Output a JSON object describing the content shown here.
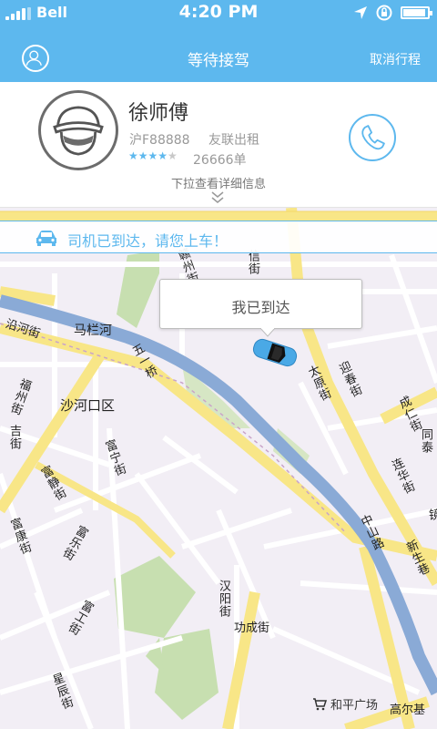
{
  "status_bar": {
    "carrier": "Bell",
    "time": "4:20 PM"
  },
  "nav": {
    "title": "等待接驾",
    "cancel_label": "取消行程",
    "profile_icon": "user-icon"
  },
  "driver": {
    "name": "徐师傅",
    "plate": "沪F88888",
    "company": "友联出租",
    "rating": {
      "value": 4,
      "max": 5,
      "stars_on": "★★★★",
      "stars_off": "★"
    },
    "orders": "26666单",
    "call_icon": "phone-icon",
    "pull_hint": "下拉查看详细信息"
  },
  "notice": {
    "icon": "car-icon",
    "text": "司机已到达，请您上车！"
  },
  "map": {
    "arrive_button": "我已到达",
    "labels": {
      "yanhe": "沿河街",
      "malan": "马栏河",
      "shahekou": "沙河口区",
      "wuyiqiao": "五一桥",
      "fuzhou": "福州街",
      "jixiang": "吉街",
      "fuquan": "富宁街",
      "fujing": "富静街",
      "fukang": "富康街",
      "fule": "富乐街",
      "fugong": "富工街",
      "xingchen": "星辰街",
      "hanyang": "汉阳街",
      "gongcheng": "功成街",
      "taiyuan": "太原街",
      "yingchun": "迎春街",
      "chengren": "成仁街",
      "lianhua": "连华街",
      "tongtai": "同泰",
      "zhongshan": "中山路",
      "xinsheng": "新生巷",
      "jing": "镜",
      "zhangzhou": "赣州街",
      "xin": "信街",
      "gaoerji": "高尔基",
      "heping": "和平广场"
    },
    "poi_icon": "shopping-cart-icon"
  },
  "colors": {
    "brand_blue": "#5db8ee",
    "road_yellow": "#f8e687",
    "river_blue": "#8aaad6",
    "park_green": "#c7dfb0"
  }
}
